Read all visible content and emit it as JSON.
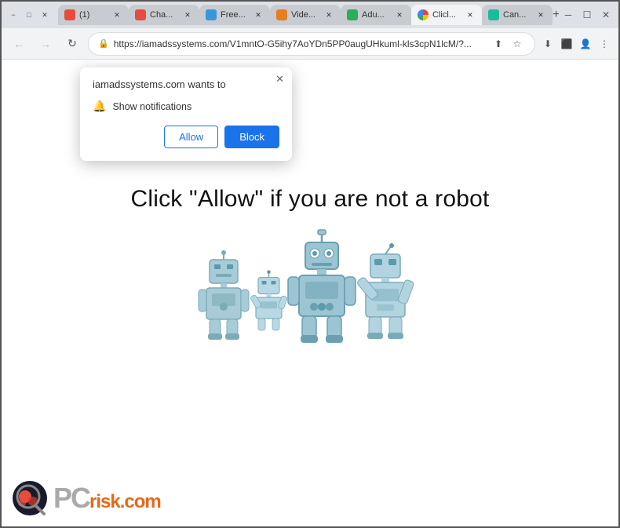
{
  "browser": {
    "title_bar": {
      "window_controls": {
        "minimize": "−",
        "maximize": "□",
        "close": "✕"
      }
    },
    "tabs": [
      {
        "id": "tab1",
        "label": "(1)",
        "favicon_class": "fav-red",
        "active": false,
        "close": "✕"
      },
      {
        "id": "tab2",
        "label": "Cha...",
        "favicon_class": "fav-red",
        "active": false,
        "close": "✕"
      },
      {
        "id": "tab3",
        "label": "Free...",
        "favicon_class": "fav-blue",
        "active": false,
        "close": "✕"
      },
      {
        "id": "tab4",
        "label": "Vide...",
        "favicon_class": "fav-orange",
        "active": false,
        "close": "✕"
      },
      {
        "id": "tab5",
        "label": "Adu...",
        "favicon_class": "fav-green",
        "active": false,
        "close": "✕"
      },
      {
        "id": "tab6",
        "label": "Clicl...",
        "favicon_class": "fav-chrome",
        "active": true,
        "close": "✕"
      },
      {
        "id": "tab7",
        "label": "Can...",
        "favicon_class": "fav-teal",
        "active": false,
        "close": "✕"
      }
    ],
    "new_tab_label": "+",
    "address_bar": {
      "back_btn": "←",
      "forward_btn": "→",
      "reload_btn": "↻",
      "url": "https://iamadssystems.com/V1mntO-G5ihy7AoYDn5PP0augUHkuml-kls3cpN1lcM/?...",
      "lock_icon": "🔒",
      "share_icon": "⬆",
      "bookmark_icon": "☆",
      "download_icon": "⬇",
      "extension_icon": "⬛",
      "profile_icon": "👤",
      "menu_icon": "⋮"
    }
  },
  "notification_popup": {
    "title": "iamadssystems.com wants to",
    "close_icon": "✕",
    "bell_icon": "🔔",
    "description": "Show notifications",
    "allow_label": "Allow",
    "block_label": "Block"
  },
  "page": {
    "heading": "Click \"Allow\"  if you are not   a robot"
  },
  "brand": {
    "name_pc": "PC",
    "name_risk": "risk",
    "domain": ".com"
  },
  "colors": {
    "allow_btn_text": "#1a73e8",
    "block_btn_bg": "#1a73e8",
    "heading": "#111111"
  }
}
